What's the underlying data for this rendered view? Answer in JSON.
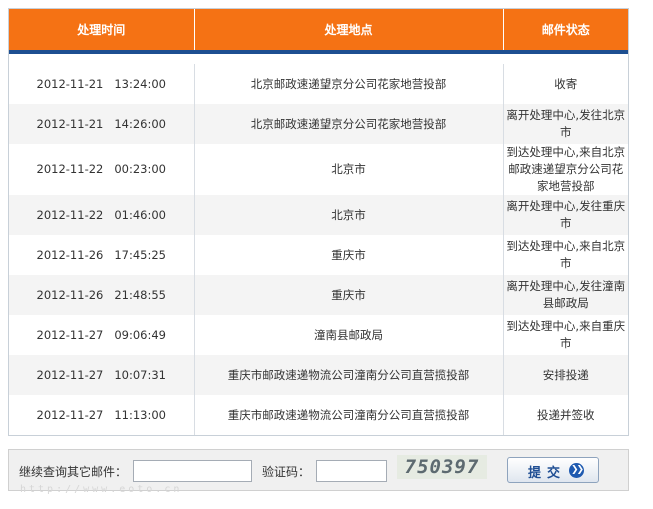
{
  "table": {
    "headers": [
      "处理时间",
      "处理地点",
      "邮件状态"
    ],
    "rows": [
      {
        "date": "2012-11-21",
        "time": "13:24:00",
        "location": "北京邮政速递望京分公司花家地营投部",
        "status": "收寄"
      },
      {
        "date": "2012-11-21",
        "time": "14:26:00",
        "location": "北京邮政速递望京分公司花家地营投部",
        "status": "离开处理中心,发往北京市"
      },
      {
        "date": "2012-11-22",
        "time": "00:23:00",
        "location": "北京市",
        "status": "到达处理中心,来自北京邮政速递望京分公司花家地营投部"
      },
      {
        "date": "2012-11-22",
        "time": "01:46:00",
        "location": "北京市",
        "status": "离开处理中心,发往重庆市"
      },
      {
        "date": "2012-11-26",
        "time": "17:45:25",
        "location": "重庆市",
        "status": "到达处理中心,来自北京市"
      },
      {
        "date": "2012-11-26",
        "time": "21:48:55",
        "location": "重庆市",
        "status": "离开处理中心,发往潼南县邮政局"
      },
      {
        "date": "2012-11-27",
        "time": "09:06:49",
        "location": "潼南县邮政局",
        "status": "到达处理中心,来自重庆市"
      },
      {
        "date": "2012-11-27",
        "time": "10:07:31",
        "location": "重庆市邮政速递物流公司潼南分公司直营揽投部",
        "status": "安排投递"
      },
      {
        "date": "2012-11-27",
        "time": "11:13:00",
        "location": "重庆市邮政速递物流公司潼南分公司直营揽投部",
        "status": "投递并签收"
      }
    ]
  },
  "query": {
    "continue_label": "继续查询其它邮件：",
    "mail_input_value": "",
    "captcha_label": "验证码：",
    "captcha_input_value": "",
    "captcha_text": "750397",
    "submit_label": "提交",
    "submit_icon": "double-chevron-right-icon"
  },
  "watermark": "http://www.eoto.cn",
  "colors": {
    "header_bg": "#f57214",
    "header_underline": "#1d4f91",
    "button_text": "#1f4e93"
  }
}
